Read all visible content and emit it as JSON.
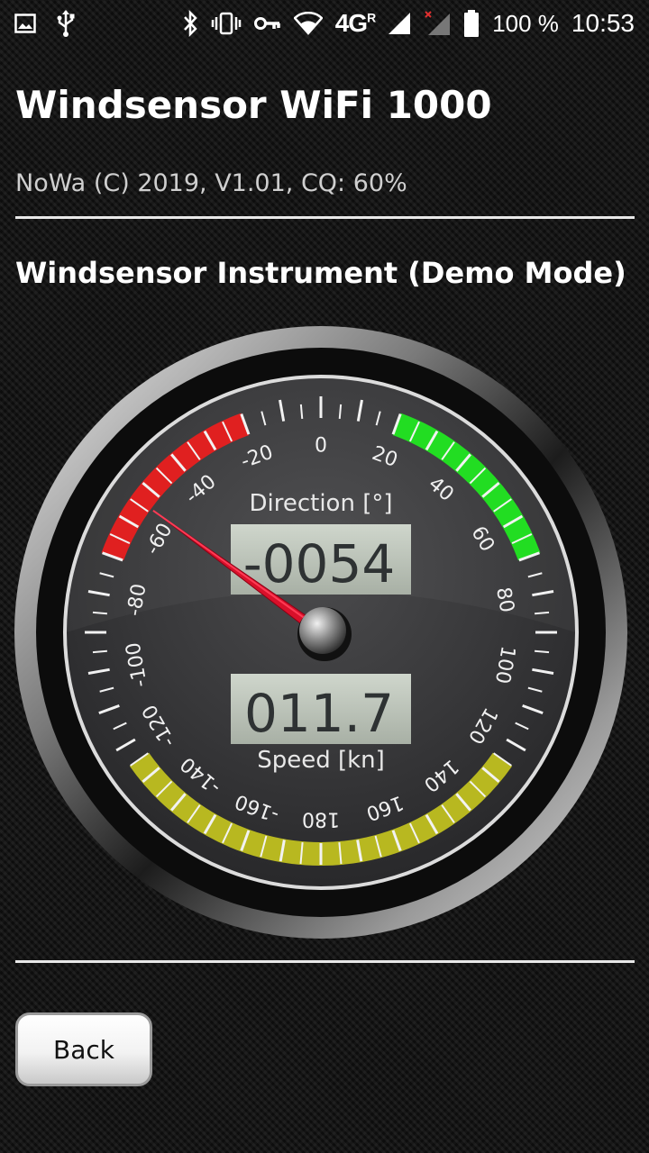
{
  "status_bar": {
    "icons_left": [
      "image-icon",
      "usb-icon"
    ],
    "icons_right": [
      "bluetooth-icon",
      "vibrate-icon",
      "vpn-key-icon",
      "wifi-icon",
      "cell-signal-icon",
      "cell-signal-no-service-icon",
      "battery-icon"
    ],
    "network": "4G",
    "network_sup": "R",
    "battery": "100 %",
    "time": "10:53"
  },
  "app": {
    "title": "Windsensor WiFi 1000",
    "subtitle": "NoWa (C) 2019, V1.01, CQ: 60%"
  },
  "instrument": {
    "heading": "Windsensor Instrument (Demo Mode)",
    "direction_label": "Direction [°]",
    "direction_value": "-0054",
    "speed_label": "Speed [kn]",
    "speed_value": "011.7",
    "needle_angle_deg": -54,
    "scale_labels_left": [
      "-20",
      "-40",
      "-60",
      "-80",
      "-100",
      "-120",
      "-140",
      "-160"
    ],
    "scale_labels_right": [
      "0",
      "20",
      "40",
      "60",
      "80",
      "100",
      "120",
      "140",
      "160",
      "180"
    ],
    "zone_colors": {
      "port": "#e02020",
      "starboard": "#22dd22",
      "downwind": "#b8b820"
    }
  },
  "nav": {
    "back_label": "Back"
  }
}
